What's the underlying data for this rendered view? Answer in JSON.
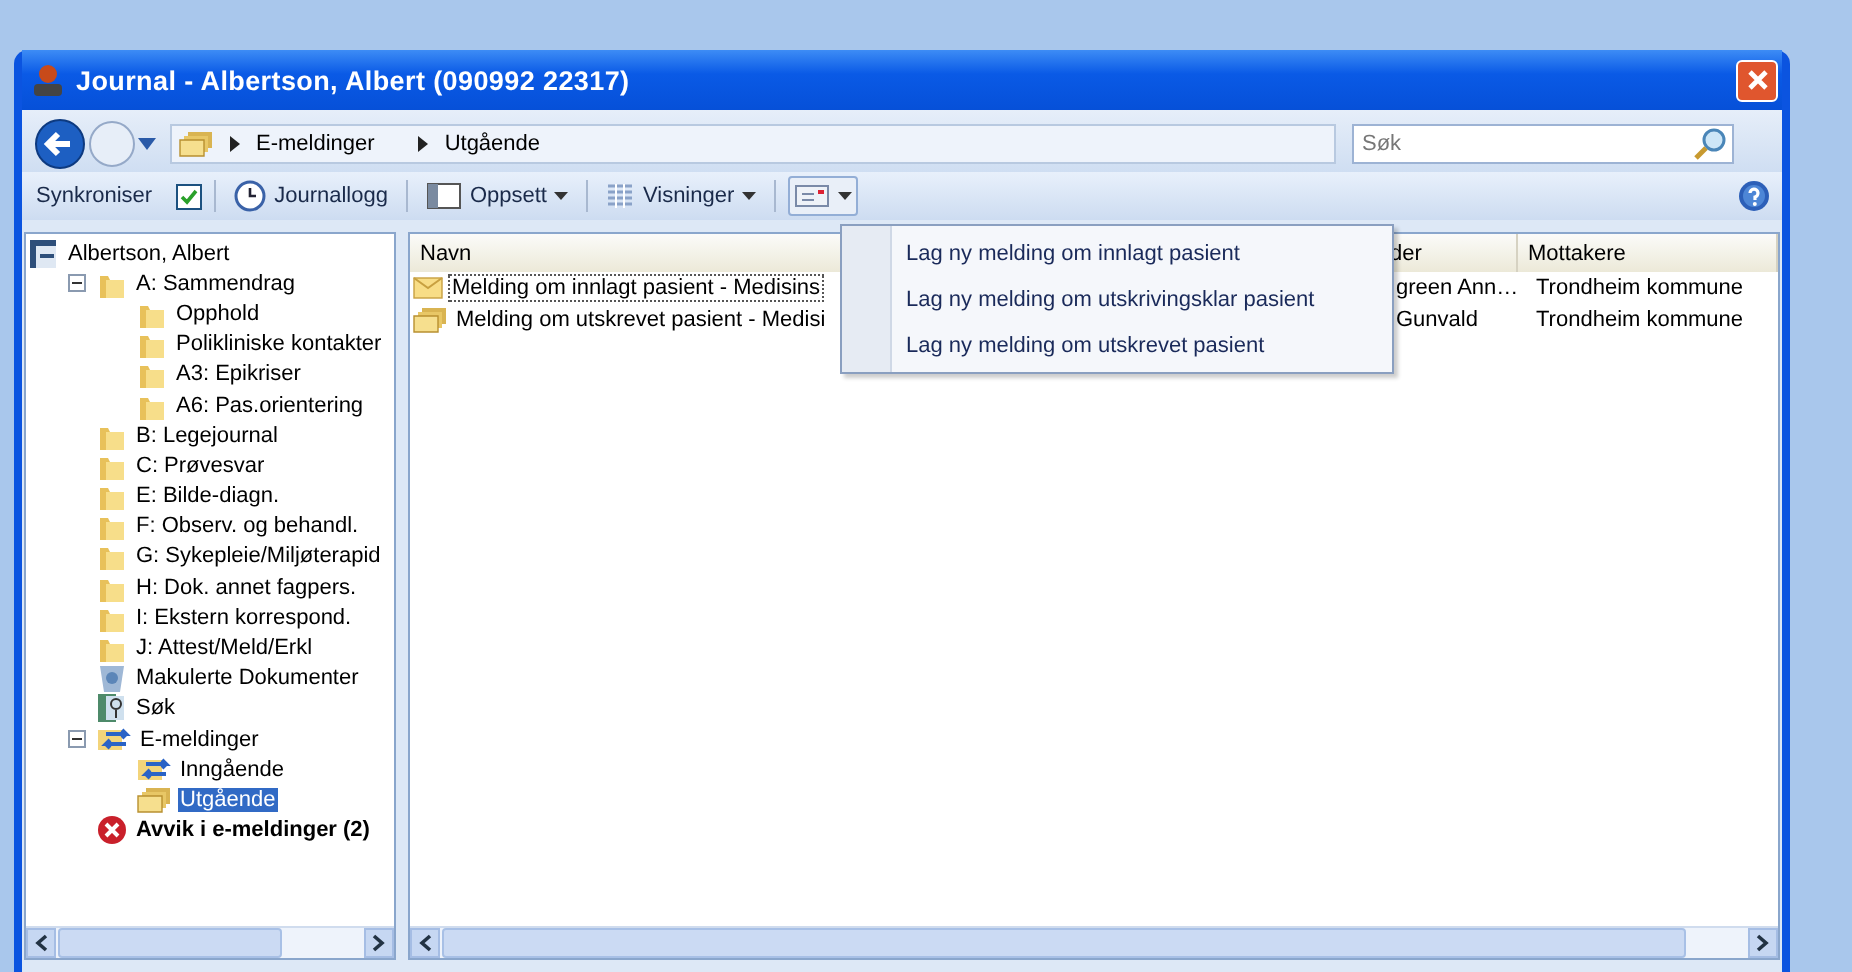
{
  "window": {
    "title": "Journal - Albertson, Albert  (090992 22317)"
  },
  "address": {
    "crumbs": [
      "E-meldinger",
      "Utgående"
    ]
  },
  "search": {
    "placeholder": "Søk"
  },
  "toolbar": {
    "sync": {
      "label": "Synkroniser",
      "checked": true
    },
    "buttons": [
      {
        "kind": "log",
        "label": "Journallogg",
        "dropdown": false,
        "pressed": false
      },
      {
        "kind": "layout",
        "label": "Oppsett",
        "dropdown": true,
        "pressed": false
      },
      {
        "kind": "views",
        "label": "Visninger",
        "dropdown": true,
        "pressed": false
      },
      {
        "kind": "message",
        "dropdown": true,
        "pressed": true
      }
    ]
  },
  "tree": [
    {
      "label": "Albertson, Albert",
      "kind": "patient",
      "selected": false,
      "children": [
        {
          "label": "A: Sammendrag",
          "kind": "folder",
          "selected": false,
          "expanded": true,
          "children": [
            {
              "label": "Opphold",
              "kind": "folder",
              "selected": false
            },
            {
              "label": "Polikliniske kontakter",
              "kind": "folder",
              "selected": false
            },
            {
              "label": "A3: Epikriser",
              "kind": "folder",
              "selected": false
            },
            {
              "label": "A6: Pas.orientering",
              "kind": "folder",
              "selected": false
            }
          ]
        },
        {
          "label": "B: Legejournal",
          "kind": "folder",
          "selected": false
        },
        {
          "label": "C: Prøvesvar",
          "kind": "folder",
          "selected": false
        },
        {
          "label": "E: Bilde-diagn.",
          "kind": "folder",
          "selected": false
        },
        {
          "label": "F: Observ. og behandl.",
          "kind": "folder",
          "selected": false
        },
        {
          "label": "G: Sykepleie/Miljøterapid",
          "kind": "folder",
          "selected": false
        },
        {
          "label": "H: Dok. annet fagpers.",
          "kind": "folder",
          "selected": false
        },
        {
          "label": "I:  Ekstern korrespond.",
          "kind": "folder",
          "selected": false
        },
        {
          "label": "J: Attest/Meld/Erkl",
          "kind": "folder",
          "selected": false
        },
        {
          "label": "Makulerte Dokumenter",
          "kind": "trash",
          "selected": false
        },
        {
          "label": "Søk",
          "kind": "search",
          "selected": false
        },
        {
          "label": "E-meldinger",
          "kind": "messages",
          "selected": false,
          "expanded": true,
          "children": [
            {
              "label": "Inngående",
              "kind": "incoming",
              "selected": false
            },
            {
              "label": "Utgående",
              "kind": "outgoing",
              "selected": true
            }
          ]
        },
        {
          "label": "Avvik i e-meldinger (2)",
          "kind": "error",
          "selected": false
        }
      ]
    }
  ],
  "table": {
    "columns": [
      "Navn",
      "der",
      "Mottakere"
    ],
    "rows": [
      {
        "kind": "envelope",
        "focused": true,
        "cells": [
          "Melding om innlagt pasient - Medisins",
          "green  Ann…",
          "Trondheim kommune"
        ]
      },
      {
        "kind": "outgoing",
        "focused": false,
        "cells": [
          "Melding om utskrevet pasient - Medisi",
          "Gunvald",
          "Trondheim kommune"
        ]
      }
    ]
  },
  "menu": {
    "items": [
      "Lag ny melding om innlagt pasient",
      "Lag ny melding om utskrivingsklar pasient",
      "Lag ny melding om utskrevet pasient"
    ]
  }
}
